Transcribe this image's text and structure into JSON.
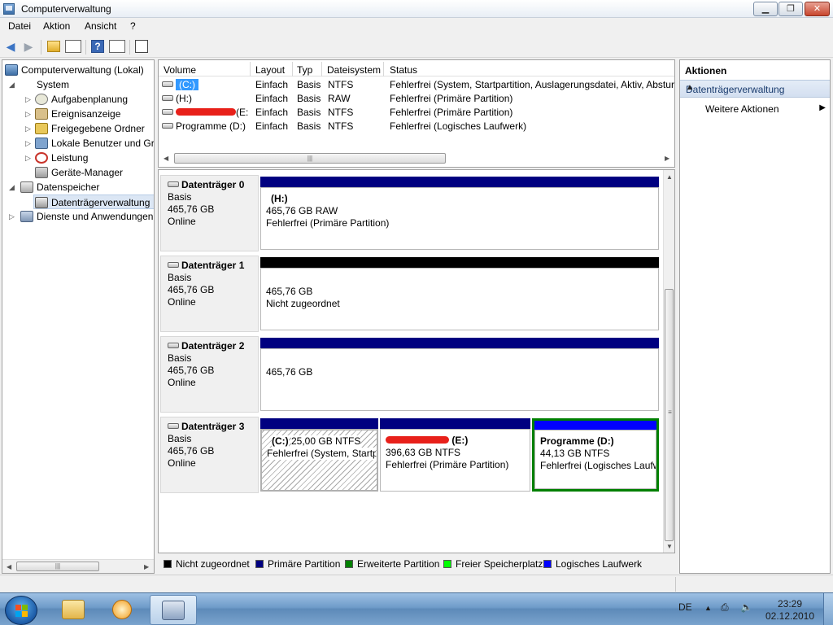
{
  "window": {
    "title": "Computerverwaltung"
  },
  "menu": {
    "items": [
      "Datei",
      "Aktion",
      "Ansicht",
      "?"
    ]
  },
  "tree": {
    "items": [
      {
        "label": "Computerverwaltung (Lokal)",
        "icon": "computer-management-icon"
      },
      {
        "label": "System",
        "icon": "tools-icon"
      },
      {
        "label": "Aufgabenplanung",
        "icon": "clock-icon"
      },
      {
        "label": "Ereignisanzeige",
        "icon": "event-viewer-icon"
      },
      {
        "label": "Freigegebene Ordner",
        "icon": "shared-folder-icon"
      },
      {
        "label": "Lokale Benutzer und Gruppen",
        "icon": "users-icon"
      },
      {
        "label": "Leistung",
        "icon": "performance-icon"
      },
      {
        "label": "Geräte-Manager",
        "icon": "device-manager-icon"
      },
      {
        "label": "Datenspeicher",
        "icon": "storage-icon"
      },
      {
        "label": "Datenträgerverwaltung",
        "icon": "disk-management-icon"
      },
      {
        "label": "Dienste und Anwendungen",
        "icon": "services-icon"
      }
    ]
  },
  "volumes": {
    "headers": [
      "Volume",
      "Layout",
      "Typ",
      "Dateisystem",
      "Status"
    ],
    "rows": [
      {
        "volume": "(C:)",
        "layout": "Einfach",
        "type": "Basis",
        "fs": "NTFS",
        "status": "Fehlerfrei (System, Startpartition, Auslagerungsdatei, Aktiv, Absturzabbild, Primäre Partition)"
      },
      {
        "volume": "(H:)",
        "layout": "Einfach",
        "type": "Basis",
        "fs": "RAW",
        "status": "Fehlerfrei (Primäre Partition)"
      },
      {
        "volume": "(E:)",
        "layout": "Einfach",
        "type": "Basis",
        "fs": "NTFS",
        "status": "Fehlerfrei (Primäre Partition)"
      },
      {
        "volume": "Programme (D:)",
        "layout": "Einfach",
        "type": "Basis",
        "fs": "NTFS",
        "status": "Fehlerfrei (Logisches Laufwerk)"
      }
    ]
  },
  "disks": [
    {
      "name": "Datenträger 0",
      "type": "Basis",
      "size": "465,76 GB",
      "state": "Online",
      "partitions": [
        {
          "label": "(H:)",
          "size": "465,76 GB RAW",
          "status": "Fehlerfrei (Primäre Partition)"
        }
      ]
    },
    {
      "name": "Datenträger 1",
      "type": "Basis",
      "size": "465,76 GB",
      "state": "Online",
      "partitions": [
        {
          "label": "",
          "size": "465,76 GB",
          "status": "Nicht zugeordnet"
        }
      ]
    },
    {
      "name": "Datenträger 2",
      "type": "Basis",
      "size": "465,76 GB",
      "state": "Online",
      "partitions": [
        {
          "label": "",
          "size": "465,76 GB",
          "status": ""
        }
      ]
    },
    {
      "name": "Datenträger 3",
      "type": "Basis",
      "size": "465,76 GB",
      "state": "Online",
      "partitions": [
        {
          "label": "(C:)",
          "size": "25,00 GB NTFS",
          "status": "Fehlerfrei (System, Startpartition)"
        },
        {
          "label": "(E:)",
          "size": "396,63 GB NTFS",
          "status": "Fehlerfrei (Primäre Partition)"
        },
        {
          "label": "Programme  (D:)",
          "size": "44,13 GB NTFS",
          "status": "Fehlerfrei (Logisches Laufwerk)"
        }
      ]
    }
  ],
  "legend": [
    {
      "label": "Nicht zugeordnet",
      "color": "#000000"
    },
    {
      "label": "Primäre Partition",
      "color": "#000080"
    },
    {
      "label": "Erweiterte Partition",
      "color": "#008000"
    },
    {
      "label": "Freier Speicherplatz",
      "color": "#00ff00"
    },
    {
      "label": "Logisches Laufwerk",
      "color": "#0000ff"
    }
  ],
  "actions": {
    "title": "Aktionen",
    "section": "Datenträgerverwaltung",
    "link": "Weitere Aktionen"
  },
  "taskbar": {
    "language": "DE",
    "time": "23:29",
    "date": "02.12.2010"
  },
  "colors": {
    "primary_bar": "#000080",
    "unallocated_bar": "#000000",
    "logical_bar": "#0000ff",
    "extended_border": "#008000",
    "selection": "#3399ff"
  }
}
